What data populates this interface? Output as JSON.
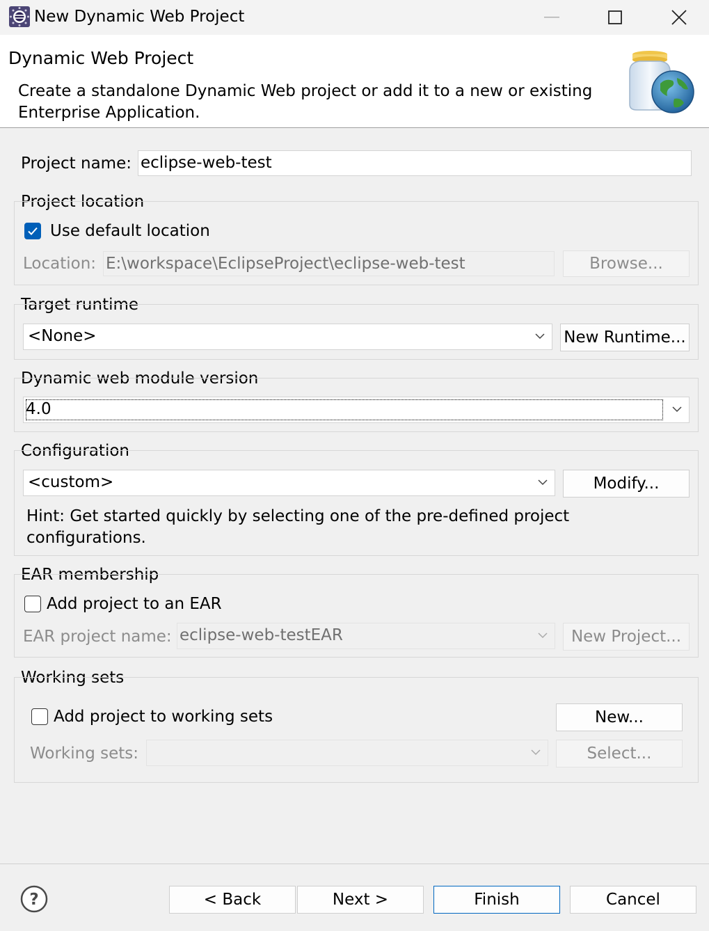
{
  "window": {
    "title": "New Dynamic Web Project"
  },
  "header": {
    "title": "Dynamic Web Project",
    "description": "Create a standalone Dynamic Web project or add it to a new or existing Enterprise Application."
  },
  "project_name": {
    "label": "Project name:",
    "value": "eclipse-web-test"
  },
  "project_location": {
    "group_label": "Project location",
    "use_default_label": "Use default location",
    "use_default_checked": true,
    "location_label": "Location:",
    "location_value": "E:\\workspace\\EclipseProject\\eclipse-web-test",
    "browse_label": "Browse..."
  },
  "target_runtime": {
    "group_label": "Target runtime",
    "selected": "<None>",
    "new_runtime_label": "New Runtime..."
  },
  "module_version": {
    "group_label": "Dynamic web module version",
    "selected": "4.0"
  },
  "configuration": {
    "group_label": "Configuration",
    "selected": "<custom>",
    "modify_label": "Modify...",
    "hint": "Hint: Get started quickly by selecting one of the pre-defined project configurations."
  },
  "ear": {
    "group_label": "EAR membership",
    "add_label": "Add project to an EAR",
    "add_checked": false,
    "name_label": "EAR project name:",
    "name_value": "eclipse-web-testEAR",
    "new_project_label": "New Project..."
  },
  "working_sets": {
    "group_label": "Working sets",
    "add_label": "Add project to working sets",
    "add_checked": false,
    "new_label": "New...",
    "sets_label": "Working sets:",
    "sets_value": "",
    "select_label": "Select..."
  },
  "footer": {
    "back_label": "< Back",
    "next_label": "Next >",
    "finish_label": "Finish",
    "cancel_label": "Cancel"
  },
  "colors": {
    "accent": "#005fb8",
    "primary_button_border": "#0067c0"
  },
  "icons": [
    "eclipse-app-icon",
    "minimize-icon",
    "maximize-icon",
    "close-icon",
    "web-project-banner-icon",
    "checkmark-icon",
    "chevron-down-icon",
    "help-icon"
  ]
}
